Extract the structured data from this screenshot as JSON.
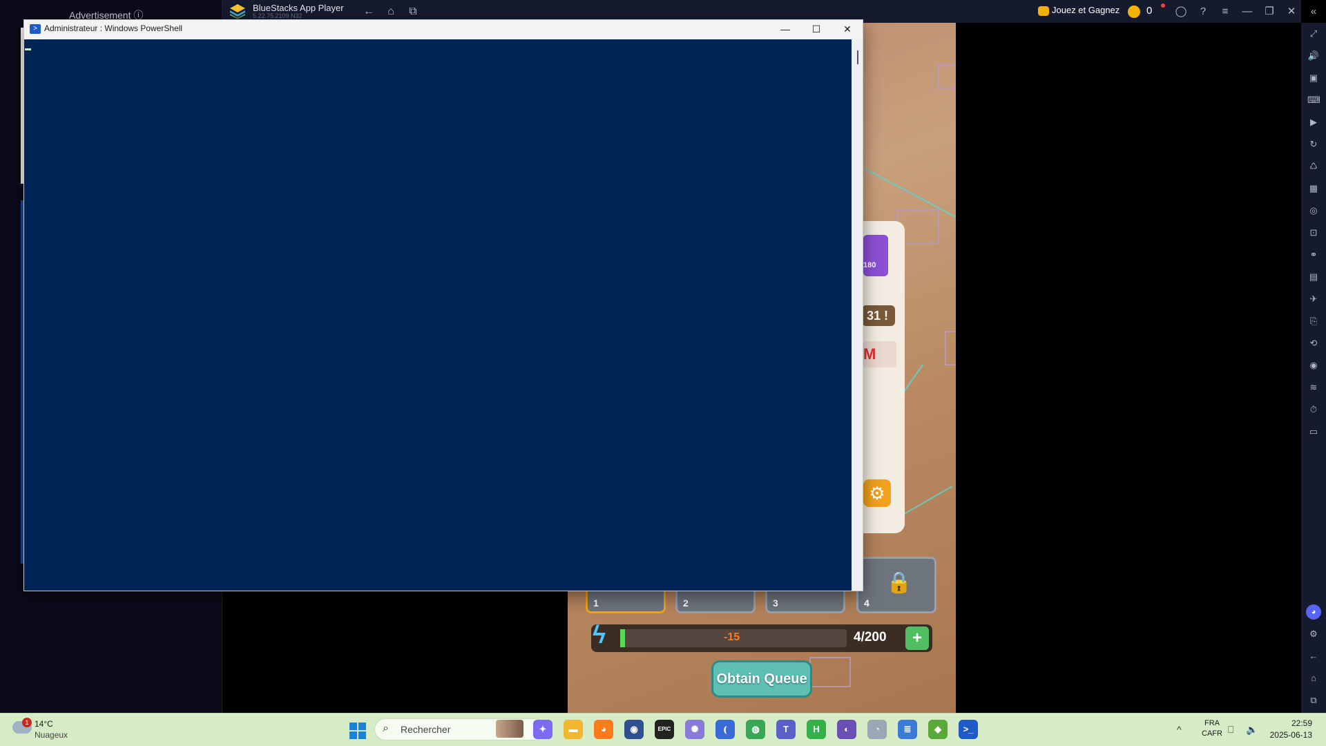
{
  "ad": {
    "label": "Advertisement ⓘ"
  },
  "bluestacks": {
    "title": "BlueStacks App Player",
    "version": "5.22.75.2109  N32",
    "nav": {
      "back": "←",
      "home": "⌂",
      "recent": "⧉"
    },
    "play_win": "Jouez et Gagnez",
    "coins": "0",
    "controls": {
      "account": "◯",
      "help": "?",
      "menu": "≡",
      "minimize": "—",
      "restore": "❐",
      "close": "✕",
      "collapse": "«"
    },
    "sidebar_icons": [
      "⤢",
      "🔊",
      "▣",
      "⌨",
      "▶",
      "↻",
      "♺",
      "▦",
      "◎",
      "⊡",
      "⚭",
      "▤",
      "✈",
      "⎘",
      "⟲",
      "◉",
      "≋",
      "⏱",
      "▭"
    ],
    "sidebar_bottom": {
      "discord": "◕",
      "settings": "⚙",
      "back": "←",
      "home": "⌂",
      "recent": "⧉"
    }
  },
  "game": {
    "card_level": "180",
    "alert_value": "31 !",
    "red_tag": "M",
    "settings_glyph": "⚙",
    "queue_slots": [
      {
        "num": "1",
        "active": true
      },
      {
        "num": "2",
        "active": false
      },
      {
        "num": "3",
        "active": false
      },
      {
        "num": "4",
        "active": false,
        "locked": true
      }
    ],
    "lock_glyph": "🔒",
    "energy": {
      "glyph": "ϟ",
      "delta": "-15",
      "count": "4/200",
      "fill": 0.02,
      "plus": "+"
    },
    "obtain_button": "Obtain Queue"
  },
  "powershell": {
    "title": "Administrateur : Windows PowerShell",
    "icon_glyph": ">",
    "controls": {
      "minimize": "—",
      "maximize": "☐",
      "close": "✕"
    },
    "colors": {
      "console_bg": "#012456"
    }
  },
  "taskbar": {
    "weather": {
      "temp": "14°C",
      "desc": "Nuageux",
      "badge": "1"
    },
    "search_placeholder": "Rechercher",
    "apps": [
      {
        "name": "copilot",
        "glyph": "✦",
        "color": "#7a6cf0"
      },
      {
        "name": "file-explorer",
        "glyph": "▬",
        "color": "#f2b630"
      },
      {
        "name": "firefox",
        "glyph": "◕",
        "color": "#ff7a1a"
      },
      {
        "name": "app-circle",
        "glyph": "◉",
        "color": "#2f4f8f"
      },
      {
        "name": "epic-games",
        "glyph": "EPIC",
        "color": "#222222"
      },
      {
        "name": "app-gear",
        "glyph": "✺",
        "color": "#8a7ad8"
      },
      {
        "name": "app-bracket",
        "glyph": "⦅",
        "color": "#3a6ad8"
      },
      {
        "name": "chrome",
        "glyph": "◍",
        "color": "#3aa757"
      },
      {
        "name": "teams",
        "glyph": "T",
        "color": "#5b5fc7"
      },
      {
        "name": "app-h",
        "glyph": "H",
        "color": "#35b04a"
      },
      {
        "name": "github",
        "glyph": "◐",
        "color": "#6a4fb5"
      },
      {
        "name": "clock-app",
        "glyph": "◔",
        "color": "#9aa7b5"
      },
      {
        "name": "notepad",
        "glyph": "≣",
        "color": "#3a7bd5"
      },
      {
        "name": "bluestacks",
        "glyph": "◆",
        "color": "#5aa83a"
      },
      {
        "name": "powershell",
        "glyph": ">_",
        "color": "#1f5bc6"
      }
    ],
    "tray": {
      "chevron": "^",
      "lang_line1": "FRA",
      "lang_line2": "CAFR",
      "network": "⎕",
      "volume": "🔈",
      "time": "22:59",
      "date": "2025-06-13"
    }
  }
}
